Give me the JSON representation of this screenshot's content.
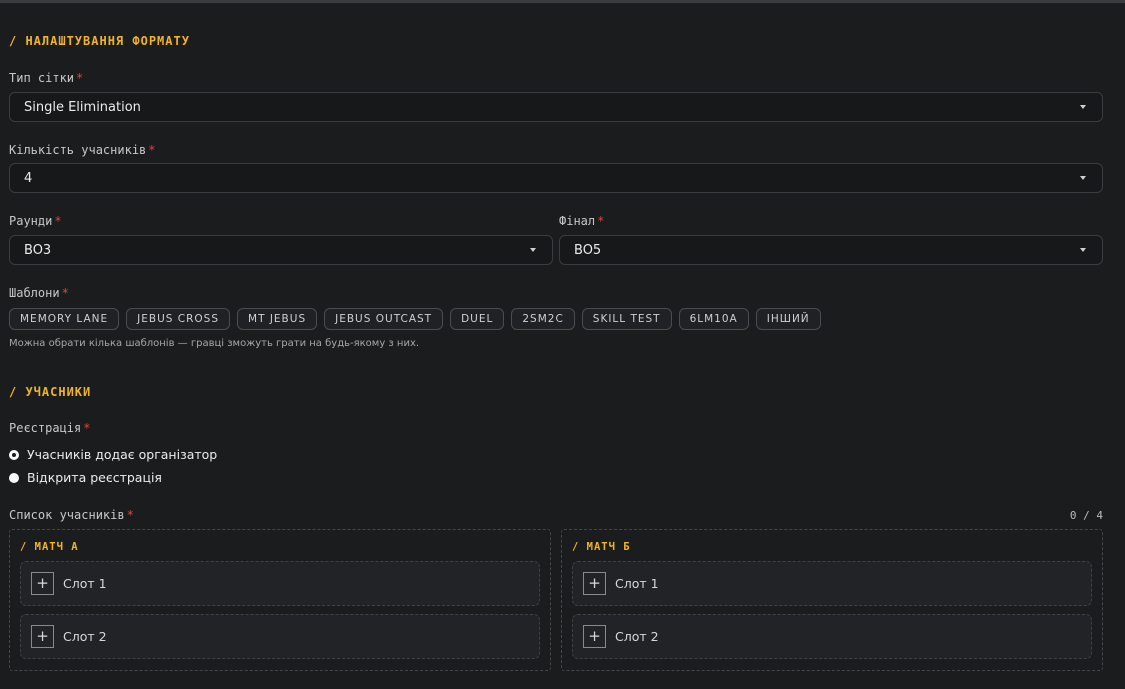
{
  "format_section": {
    "title": "/ НАЛАШТУВАННЯ ФОРМАТУ",
    "bracket_type": {
      "label": "Тип сітки",
      "required": "*",
      "value": "Single Elimination"
    },
    "participants_count": {
      "label": "Кількість учасників",
      "required": "*",
      "value": "4"
    },
    "rounds": {
      "label": "Раунди",
      "required": "*",
      "value": "BO3"
    },
    "final": {
      "label": "Фінал",
      "required": "*",
      "value": "BO5"
    },
    "templates": {
      "label": "Шаблони",
      "required": "*",
      "chips": [
        "MEMORY LANE",
        "JEBUS CROSS",
        "MT JEBUS",
        "JEBUS OUTCAST",
        "DUEL",
        "2SM2C",
        "SKILL TEST",
        "6LM10A",
        "ІНШИЙ"
      ],
      "hint": "Можна обрати кілька шаблонів — гравці зможуть грати на будь-якому з них."
    }
  },
  "participants_section": {
    "title": "/ УЧАСНИКИ",
    "registration": {
      "label": "Реєстрація",
      "required": "*",
      "options": [
        {
          "label": "Учасників додає організатор",
          "selected": true
        },
        {
          "label": "Відкрита реєстрація",
          "selected": false
        }
      ]
    },
    "list": {
      "label": "Список учасників",
      "required": "*",
      "counter": "0 / 4",
      "matches": [
        {
          "title": "/ МАТЧ А",
          "slots": [
            "Слот 1",
            "Слот 2"
          ]
        },
        {
          "title": "/ МАТЧ Б",
          "slots": [
            "Слот 1",
            "Слот 2"
          ]
        }
      ]
    }
  },
  "icons": {
    "caret": "chevron-down-icon",
    "add": "plus-icon"
  },
  "colors": {
    "accent": "#f0b429",
    "required": "#e0443e",
    "background": "#1b1c1e"
  }
}
